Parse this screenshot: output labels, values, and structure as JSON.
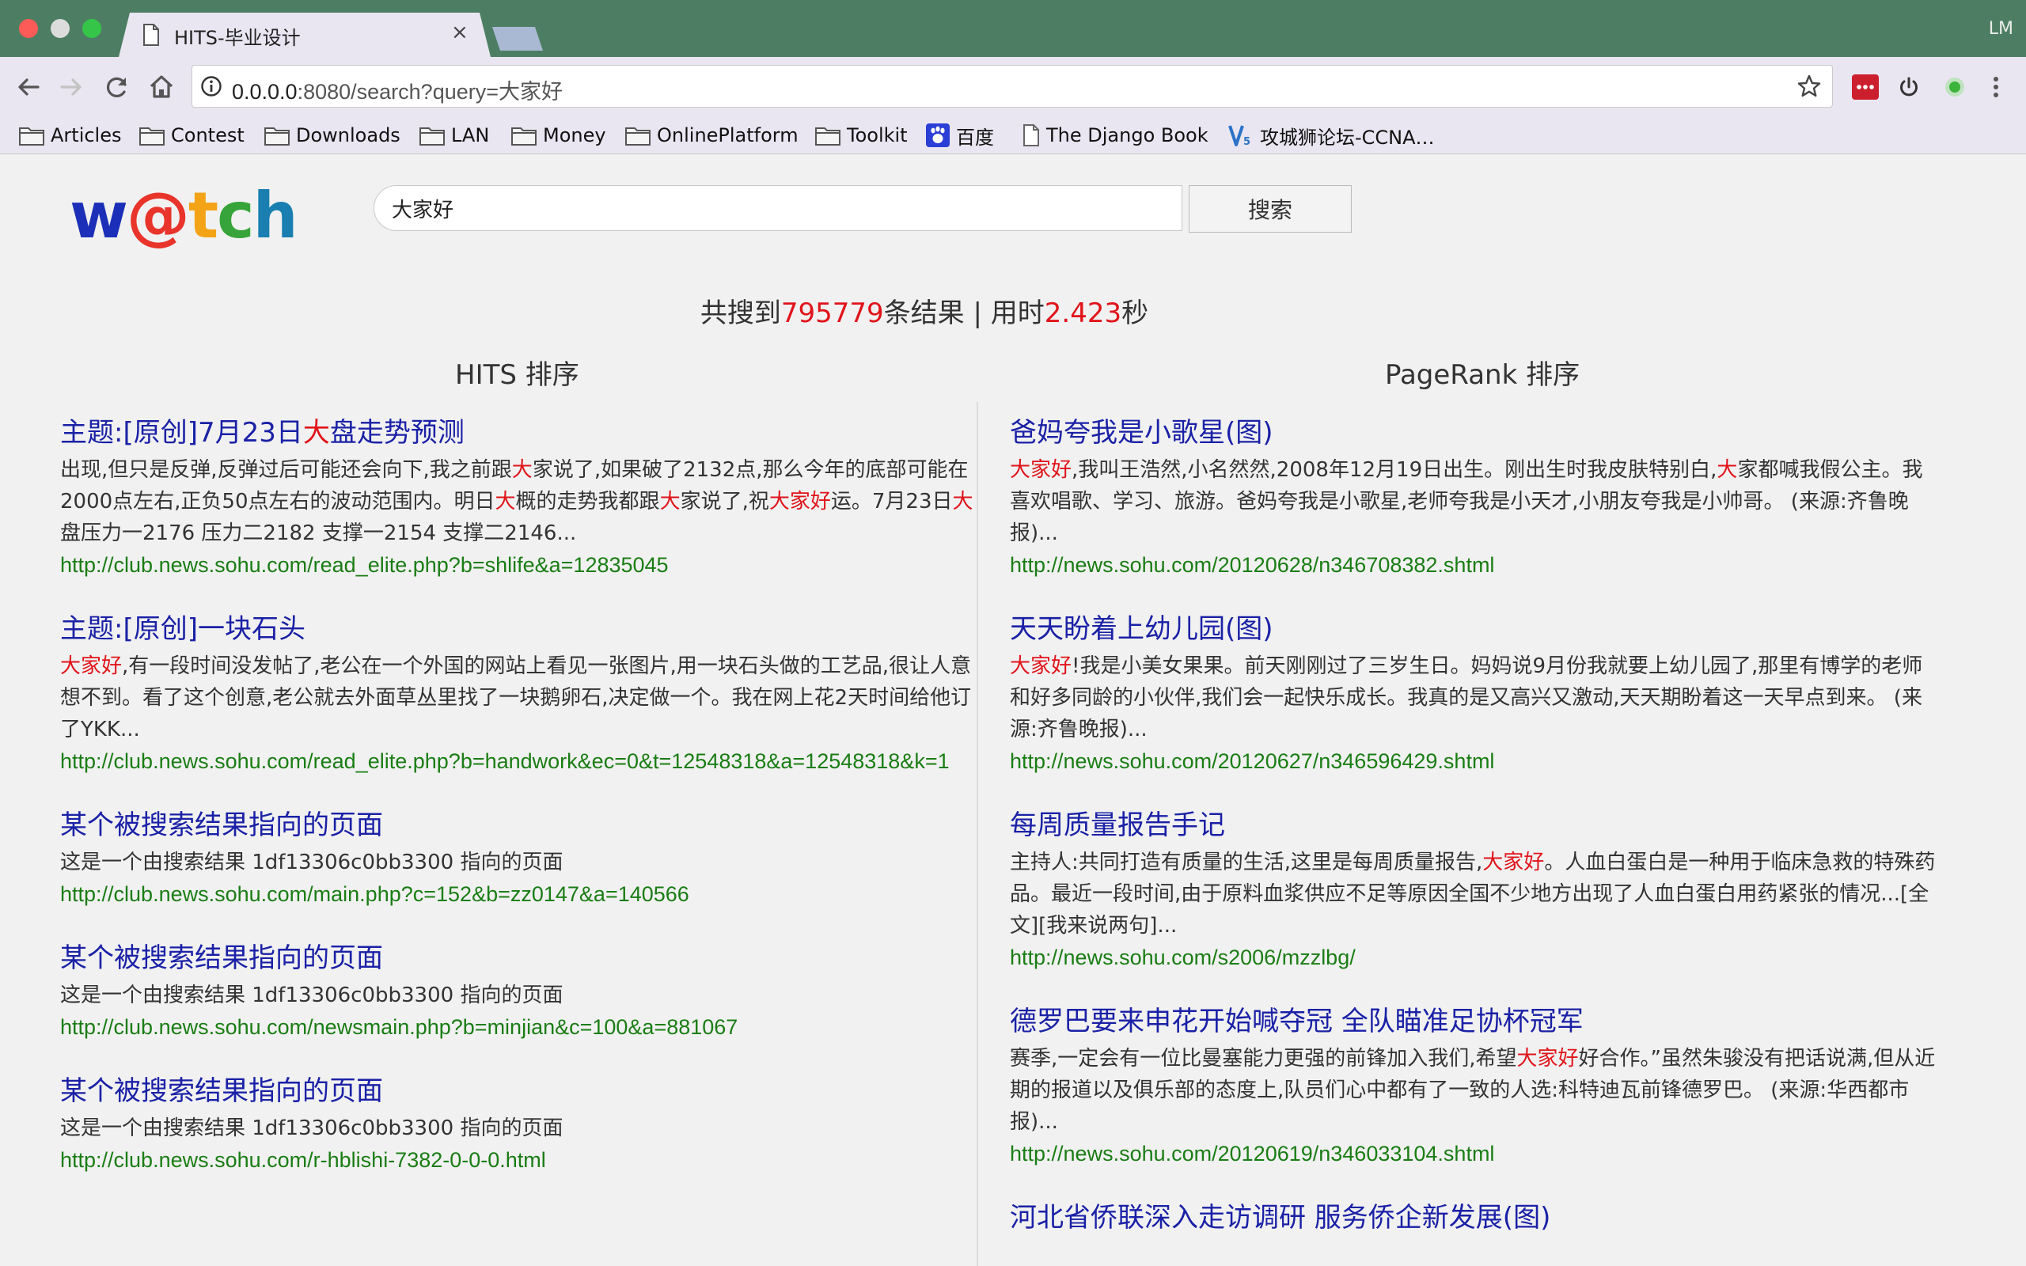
{
  "browser": {
    "tab_title": "HITS-毕业设计",
    "tab_close": "×",
    "profile": "LM",
    "url_host": "0.0.0.0",
    "url_rest": ":8080/search?query=大家好",
    "bookmarks": [
      {
        "label": "Articles",
        "icon": "folder-icon"
      },
      {
        "label": "Contest",
        "icon": "folder-icon"
      },
      {
        "label": "Downloads",
        "icon": "folder-icon"
      },
      {
        "label": "LAN",
        "icon": "folder-icon"
      },
      {
        "label": "Money",
        "icon": "folder-icon"
      },
      {
        "label": "OnlinePlatform",
        "icon": "folder-icon"
      },
      {
        "label": "Toolkit",
        "icon": "folder-icon"
      },
      {
        "label": "百度",
        "icon": "baidu-paw-icon"
      },
      {
        "label": "The Django Book",
        "icon": "page-icon"
      },
      {
        "label": "攻城狮论坛-CCNA…",
        "icon": "v5-logo-icon"
      }
    ]
  },
  "page": {
    "logo": [
      "w",
      "@",
      "t",
      "c",
      "h"
    ],
    "logo_colors": [
      "#1c2fb8",
      "#e8342a",
      "#f3a416",
      "#36a43a",
      "#1a7fb0"
    ],
    "search_value": "大家好",
    "search_button": "搜索",
    "stats": {
      "prefix": "共搜到",
      "count": "795779",
      "mid": "条结果 | 用时",
      "time": "2.423",
      "suffix": "秒"
    },
    "hits_heading": "HITS 排序",
    "pagerank_heading": "PageRank 排序"
  },
  "hits_results": [
    {
      "title": [
        {
          "t": "主题:[原创]7月23日"
        },
        {
          "t": "大",
          "hl": true
        },
        {
          "t": "盘走势预测"
        }
      ],
      "snippet": [
        {
          "t": "出现,但只是反弹,反弹过后可能还会向下,我之前跟"
        },
        {
          "t": "大",
          "hl": true
        },
        {
          "t": "家说了,如果破了2132点,那么今年的底部可能在2000点左右,正负50点左右的波动范围内。明日"
        },
        {
          "t": "大",
          "hl": true
        },
        {
          "t": "概的走势我都跟"
        },
        {
          "t": "大",
          "hl": true
        },
        {
          "t": "家说了,祝"
        },
        {
          "t": "大家好",
          "hl": true
        },
        {
          "t": "运。7月23日"
        },
        {
          "t": "大",
          "hl": true
        },
        {
          "t": "盘压力一2176 压力二2182 支撑一2154 支撑二2146..."
        }
      ],
      "url": "http://club.news.sohu.com/read_elite.php?b=shlife&a=12835045"
    },
    {
      "title": [
        {
          "t": "主题:[原创]一块石头"
        }
      ],
      "snippet": [
        {
          "t": "大家好",
          "hl": true
        },
        {
          "t": ",有一段时间没发帖了,老公在一个外国的网站上看见一张图片,用一块石头做的工艺品,很让人意想不到。看了这个创意,老公就去外面草丛里找了一块鹅卵石,决定做一个。我在网上花2天时间给他订了YKK..."
        }
      ],
      "url": "http://club.news.sohu.com/read_elite.php?b=handwork&ec=0&t=12548318&a=12548318&k=1"
    },
    {
      "title": [
        {
          "t": "某个被搜索结果指向的页面"
        }
      ],
      "snippet": [
        {
          "t": "这是一个由搜索结果 1df13306c0bb3300 指向的页面"
        }
      ],
      "url": "http://club.news.sohu.com/main.php?c=152&b=zz0147&a=140566"
    },
    {
      "title": [
        {
          "t": "某个被搜索结果指向的页面"
        }
      ],
      "snippet": [
        {
          "t": "这是一个由搜索结果 1df13306c0bb3300 指向的页面"
        }
      ],
      "url": "http://club.news.sohu.com/newsmain.php?b=minjian&c=100&a=881067"
    },
    {
      "title": [
        {
          "t": "某个被搜索结果指向的页面"
        }
      ],
      "snippet": [
        {
          "t": "这是一个由搜索结果 1df13306c0bb3300 指向的页面"
        }
      ],
      "url": "http://club.news.sohu.com/r-hblishi-7382-0-0-0.html"
    }
  ],
  "pagerank_results": [
    {
      "title": [
        {
          "t": "爸妈夸我是小歌星(图)"
        }
      ],
      "snippet": [
        {
          "t": "大家好",
          "hl": true
        },
        {
          "t": ",我叫王浩然,小名然然,2008年12月19日出生。刚出生时我皮肤特别白,"
        },
        {
          "t": "大",
          "hl": true
        },
        {
          "t": "家都喊我假公主。我喜欢唱歌、学习、旅游。爸妈夸我是小歌星,老师夸我是小天才,小朋友夸我是小帅哥。 (来源:齐鲁晚报)..."
        }
      ],
      "url": "http://news.sohu.com/20120628/n346708382.shtml"
    },
    {
      "title": [
        {
          "t": "天天盼着上幼儿园(图)"
        }
      ],
      "snippet": [
        {
          "t": "大家好",
          "hl": true
        },
        {
          "t": "!我是小美女果果。前天刚刚过了三岁生日。妈妈说9月份我就要上幼儿园了,那里有博学的老师和好多同龄的小伙伴,我们会一起快乐成长。我真的是又高兴又激动,天天期盼着这一天早点到来。 (来源:齐鲁晚报)..."
        }
      ],
      "url": "http://news.sohu.com/20120627/n346596429.shtml"
    },
    {
      "title": [
        {
          "t": "每周质量报告手记"
        }
      ],
      "snippet": [
        {
          "t": "主持人:共同打造有质量的生活,这里是每周质量报告,"
        },
        {
          "t": "大家好",
          "hl": true
        },
        {
          "t": "。人血白蛋白是一种用于临床急救的特殊药品。最近一段时间,由于原料血浆供应不足等原因全国不少地方出现了人血白蛋白用药紧张的情况...[全文][我来说两句]..."
        }
      ],
      "url": "http://news.sohu.com/s2006/mzzlbg/"
    },
    {
      "title": [
        {
          "t": "德罗巴要来申花开始喊夺冠 全队瞄准足协杯冠军"
        }
      ],
      "snippet": [
        {
          "t": "赛季,一定会有一位比曼塞能力更强的前锋加入我们,希望"
        },
        {
          "t": "大家好",
          "hl": true
        },
        {
          "t": "好合作。”虽然朱骏没有把话说满,但从近期的报道以及俱乐部的态度上,队员们心中都有了一致的人选:科特迪瓦前锋德罗巴。 (来源:华西都市报)..."
        }
      ],
      "url": "http://news.sohu.com/20120619/n346033104.shtml"
    },
    {
      "title": [
        {
          "t": "河北省侨联深入走访调研 服务侨企新发展(图)"
        }
      ],
      "snippet": [],
      "url": ""
    }
  ]
}
